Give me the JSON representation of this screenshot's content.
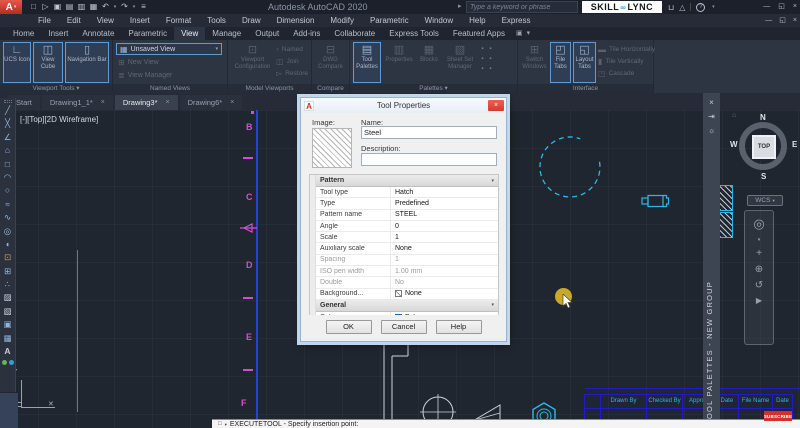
{
  "window": {
    "app_title": "Autodesk AutoCAD 2020",
    "search_placeholder": "Type a keyword or phrase",
    "brand_left": "SKILL",
    "brand_right": "LYNC"
  },
  "menu": {
    "items": [
      "File",
      "Edit",
      "View",
      "Insert",
      "Format",
      "Tools",
      "Draw",
      "Dimension",
      "Modify",
      "Parametric",
      "Window",
      "Help",
      "Express"
    ]
  },
  "ribbon": {
    "tabs": [
      "Home",
      "Insert",
      "Annotate",
      "Parametric",
      "View",
      "Manage",
      "Output",
      "Add-ins",
      "Collaborate",
      "Express Tools",
      "Featured Apps"
    ],
    "panels": {
      "viewport_tools": {
        "label": "Viewport Tools",
        "buttons": [
          {
            "label": "UCS Icon"
          },
          {
            "label": "View Cube"
          },
          {
            "label": "Navigation Bar"
          }
        ]
      },
      "named_views": {
        "label": "Named Views",
        "dropdown": "Unsaved View",
        "items": [
          {
            "label": "New View"
          },
          {
            "label": "View Manager"
          }
        ]
      },
      "model_viewports": {
        "label": "Model Viewports",
        "big_button": "Viewport Configuration",
        "items": [
          {
            "label": "Named"
          },
          {
            "label": "Join"
          },
          {
            "label": "Restore"
          }
        ]
      },
      "compare": {
        "label": "Compare",
        "big_button": "DWG Compare"
      },
      "palettes": {
        "label": "Palettes",
        "buttons": [
          {
            "label": "Tool Palettes"
          },
          {
            "label": "Properties"
          },
          {
            "label": "Blocks"
          },
          {
            "label": "Sheet Set Manager"
          }
        ]
      },
      "interface": {
        "label": "Interface",
        "buttons": [
          {
            "label": "Switch Windows"
          },
          {
            "label": "File Tabs"
          },
          {
            "label": "Layout Tabs"
          }
        ],
        "items": [
          {
            "label": "Tile Horizontally"
          },
          {
            "label": "Tile Vertically"
          },
          {
            "label": "Cascade"
          }
        ]
      }
    }
  },
  "file_tabs": {
    "items": [
      {
        "label": "Start"
      },
      {
        "label": "Drawing1_1*"
      },
      {
        "label": "Drawing3*"
      },
      {
        "label": "Drawing6*"
      }
    ]
  },
  "viewport": {
    "label": "[-][Top][2D Wireframe]"
  },
  "viewcube": {
    "north": "N",
    "west": "W",
    "east": "E",
    "south": "S",
    "face": "TOP",
    "wcs": "WCS"
  },
  "palette": {
    "title": "TOOL PALETTES - NEW GROUP"
  },
  "toolbar_left": {
    "tools": [
      {
        "name": "line",
        "glyph": "╱"
      },
      {
        "name": "construction-line",
        "glyph": "╳"
      },
      {
        "name": "polyline",
        "glyph": "∠"
      },
      {
        "name": "polygon",
        "glyph": "⌂"
      },
      {
        "name": "rectangle",
        "glyph": "□"
      },
      {
        "name": "arc",
        "glyph": "◠"
      },
      {
        "name": "circle",
        "glyph": "○"
      },
      {
        "name": "revision-cloud",
        "glyph": "≈"
      },
      {
        "name": "spline",
        "glyph": "∿"
      },
      {
        "name": "ellipse",
        "glyph": "◎"
      },
      {
        "name": "ellipse-arc",
        "glyph": "◖"
      },
      {
        "name": "insert-block",
        "glyph": "⊡"
      },
      {
        "name": "make-block",
        "glyph": "⊞"
      },
      {
        "name": "point",
        "glyph": "∴"
      },
      {
        "name": "hatch",
        "glyph": "▨"
      },
      {
        "name": "gradient",
        "glyph": "▧"
      },
      {
        "name": "region",
        "glyph": "▣"
      },
      {
        "name": "table",
        "glyph": "▦"
      },
      {
        "name": "mtext",
        "glyph": "A"
      }
    ]
  },
  "dialog": {
    "title": "Tool Properties",
    "image_label": "Image:",
    "name_label": "Name:",
    "name_value": "Steel",
    "description_label": "Description:",
    "description_value": "",
    "sections": [
      {
        "title": "Pattern",
        "rows": [
          {
            "label": "Tool type",
            "value": "Hatch"
          },
          {
            "label": "Type",
            "value": "Predefined"
          },
          {
            "label": "Pattern name",
            "value": "STEEL"
          },
          {
            "label": "Angle",
            "value": "0"
          },
          {
            "label": "Scale",
            "value": "1"
          },
          {
            "label": "Auxiliary scale",
            "value": "None"
          },
          {
            "label": "Spacing",
            "value": "1"
          },
          {
            "label": "ISO pen width",
            "value": "1.00 mm"
          },
          {
            "label": "Double",
            "value": "No"
          },
          {
            "label": "Background...",
            "value": "None"
          }
        ]
      },
      {
        "title": "General",
        "rows": [
          {
            "label": "Color",
            "value": "ByLayer"
          }
        ]
      }
    ],
    "ok": "OK",
    "cancel": "Cancel",
    "help": "Help"
  },
  "drawing": {
    "grid_labels": [
      "B",
      "C",
      "D",
      "E",
      "F"
    ]
  },
  "title_block": {
    "headers": [
      "Drawn By",
      "Checked By",
      "Appro",
      "- Date",
      "File Name",
      "Date"
    ]
  },
  "command_line": {
    "prompt": "EXECUTETOOL - Specify insertion point:"
  },
  "subscribe_label": "SUBSCRIBE",
  "colors": {
    "accent_blue": "#5f9bd6",
    "cyan": "#2bb9e8",
    "magenta": "#d24fd2",
    "yellow": "#c8a829",
    "close_red": "#e04b40"
  },
  "icons": {
    "app_logo": "A",
    "dd": "▾",
    "new": "□",
    "open": "▷",
    "save": "▣",
    "saveas": "▤",
    "plot": "▥",
    "print": "▦",
    "undo": "↶",
    "redo": "↷",
    "overflow": "≡",
    "search_arrow": "▸",
    "cart": "⊔",
    "education": "△",
    "help_q": "?",
    "minimize": "—",
    "restore": "◱",
    "close": "×",
    "brand_link": "∞",
    "tab_close": "×",
    "camera": "▣",
    "ucs": "∟",
    "view_cube": "◫",
    "nav_bar": "▯",
    "unsaved_view": "▦",
    "new_view": "⊞",
    "view_manager": "≣",
    "vp_config": "⊡",
    "named_vp": "▫",
    "join_vp": "◫",
    "restore_vp": "▻",
    "dwg_compare": "⊟",
    "tool_palettes": "▤",
    "properties": "▥",
    "blocks": "▦",
    "sheet_set": "▧",
    "small_sq": "▪",
    "switch_windows": "⊞",
    "file_tabs_btn": "◰",
    "layout_tabs_btn": "◱",
    "tile_h": "▬",
    "tile_v": "▮",
    "cascade": "◳",
    "pin": "⇥",
    "gear": "☼",
    "wheel": "◎",
    "pan": "+",
    "zoom": "⊕",
    "orbit": "↺",
    "motion": "▶",
    "home": "⌂",
    "cmd_box": "□",
    "ucs_x": "✕"
  }
}
